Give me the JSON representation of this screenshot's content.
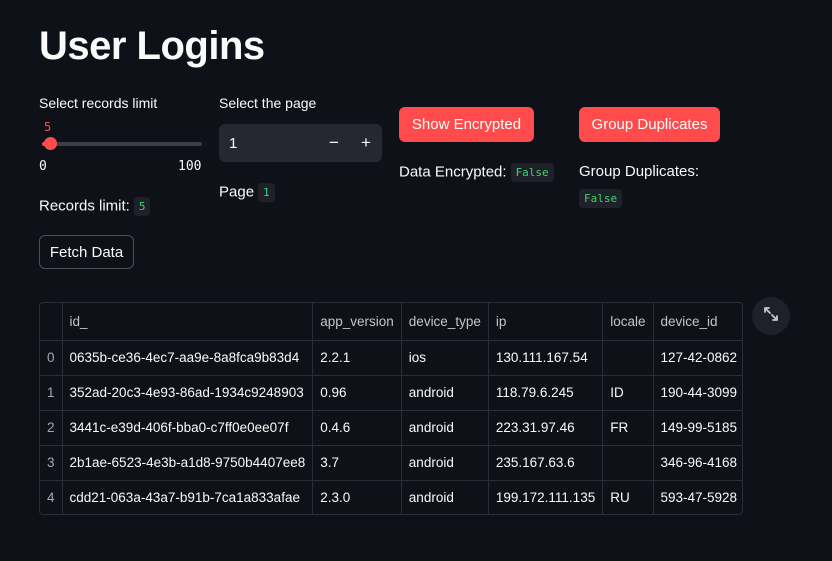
{
  "title": "User Logins",
  "slider": {
    "label": "Select records limit",
    "value": "5",
    "min_label": "0",
    "max_label": "100",
    "min": 0,
    "max": 100,
    "current": 5
  },
  "records": {
    "label": "Records limit:",
    "value": "5"
  },
  "fetch_button": "Fetch Data",
  "page_input": {
    "label": "Select the page",
    "value": "1",
    "minus": "−",
    "plus": "+"
  },
  "page_line": {
    "label": "Page",
    "value": "1"
  },
  "encrypt": {
    "button": "Show Encrypted",
    "label": "Data Encrypted:",
    "value": "False"
  },
  "group": {
    "button": "Group Duplicates",
    "label": "Group Duplicates:",
    "value": "False"
  },
  "table": {
    "columns": [
      "_id",
      "app_version",
      "device_type",
      "ip",
      "locale",
      "device_id"
    ],
    "rows": [
      {
        "index": "0",
        "cells": [
          "0635b-ce36-4ec7-aa9e-8a8fca9b83d4",
          "2.2.1",
          "ios",
          "130.111.167.54",
          "",
          "127-42-0862"
        ]
      },
      {
        "index": "1",
        "cells": [
          "352ad-20c3-4e93-86ad-1934c9248903",
          "0.96",
          "android",
          "118.79.6.245",
          "ID",
          "190-44-3099"
        ]
      },
      {
        "index": "2",
        "cells": [
          "3441c-e39d-406f-bba0-c7ff0e0ee07f",
          "0.4.6",
          "android",
          "223.31.97.46",
          "FR",
          "149-99-5185"
        ]
      },
      {
        "index": "3",
        "cells": [
          "2b1ae-6523-4e3b-a1d8-9750b4407ee8",
          "3.7",
          "android",
          "235.167.63.6",
          "",
          "346-96-4168"
        ]
      },
      {
        "index": "4",
        "cells": [
          "cdd21-063a-43a7-b91b-7ca1a833afae",
          "2.3.0",
          "android",
          "199.172.111.135",
          "RU",
          "593-47-5928"
        ]
      }
    ]
  },
  "colors": {
    "accent": "#ff4b4b",
    "code_text": "#3dd56d",
    "background": "#0e1117"
  },
  "icons": {
    "expand": "expand-icon"
  }
}
